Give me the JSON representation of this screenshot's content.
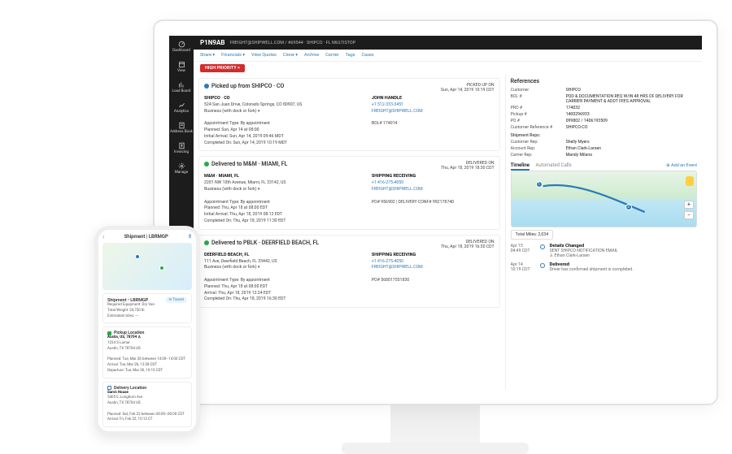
{
  "sidebar_items": [
    "Dashboard",
    "View",
    "Load Board",
    "Analytics",
    "Address Book",
    "Invoicing",
    "Manage"
  ],
  "header": {
    "load_id": "P1N9AB",
    "breadcrumb": "FREIGHT@SHIPWELL.COM / #69544 · SHIPCO · FL MULTISTOP"
  },
  "actions": {
    "share": "Share ▾",
    "financials": "Financials ▾",
    "view_quotes": "View Quotes",
    "clone": "Clone ▾",
    "archive": "Archive",
    "carrier": "Carrier",
    "tags": "Tags",
    "cases": "Cases"
  },
  "priority_tag": "HIGH PRIORITY ×",
  "stops": [
    {
      "status": "pickup",
      "status_dot": "blue",
      "title": "Picked up from SHIPCO · CO",
      "right_label": "PICKED UP ON",
      "right_date": "Sun, Apr 14, 2019 10:19 CDT",
      "block1": {
        "heading": "SHIPCO · CO",
        "addr": "524 San Juan Drive, Colorado Springs, CO 80907, US",
        "hours": "Business (with dock or fork) ▾",
        "l1": "Appointment Type: By appointment",
        "l2": "Planned: Sun, Apr 14 at 08:00",
        "l3": "Initial Arrival: Sun, Apr 14, 2019 09:46 MDT",
        "l4": "Completed On: Sun, Apr 14, 2019 10:19 MDT"
      },
      "block2": {
        "heading": "JOHN HANDLE",
        "phone": "+1 512-333-3451",
        "email": "FREIGHT@SHIPWELL.COM",
        "bol": "BOL# 174014"
      }
    },
    {
      "status": "delivered",
      "status_dot": "green",
      "title": "Delivered to M&M · MIAMI, FL",
      "right_label": "DELIVERED ON",
      "right_date": "Thu, Apr 18, 2019 18:30 CDT",
      "block1": {
        "heading": "M&M · MIAMI, FL",
        "addr": "2281 NW 10th Avenue, Miami, FL 33142, US",
        "hours": "Business (with dock or fork) ▾",
        "l1": "Appointment Type: By appointment",
        "l2": "Planned: Thu, Apr 18 at 08:00 EDT",
        "l3": "Initial Arrival: Thu, Apr 18, 2019 08:12 EDT",
        "l4": "Completed On: Thu, Apr 18, 2019 11:30 EDT"
      },
      "block2": {
        "heading": "SHIPPING RECEIVING",
        "phone": "+1 416-275-4050",
        "email": "FREIGHT@SHIPWELL.COM",
        "bol": "PO# 956902 | DELIVERY CONF# 992178740"
      }
    },
    {
      "status": "delivered",
      "status_dot": "green",
      "title": "Delivered to PBLK · DEERFIELD BEACH, FL",
      "right_label": "DELIVERED ON",
      "right_date": "Thu, Apr 18, 2019 16:30 CDT",
      "block1": {
        "heading": "DEERFIELD BEACH, FL",
        "addr": "111 Ave, Deerfield Beach, FL 33442, US",
        "hours": "Business (with dock or fork) ▾",
        "l1": "Appointment Type: By appointment",
        "l2": "Planned: Thu, Apr 18 at 08:00 EDT",
        "l3": "Arrival: Thu, Apr 18, 2019 12:24 EDT",
        "l4": "Completed On: Thu, Apr 18, 2019 16:30 EDT"
      },
      "block2": {
        "heading": "SHIPPING RECEIVING",
        "phone": "+1 416-275-4050",
        "email": "FREIGHT@SHIPWELL.COM",
        "bol": "PO# 568017551830"
      }
    }
  ],
  "references": {
    "title": "References",
    "rows": [
      {
        "k": "Customer",
        "v": "SHIPCO"
      },
      {
        "k": "BOL #",
        "v": "POD & DOCUMENTATION REQ W/IN 48 HRS OF DELIVERY FOR CARRIER PAYMENT & ADDT FEES APPROVAL"
      },
      {
        "k": "PRO #",
        "v": "174032"
      },
      {
        "k": "Pickup #",
        "v": "1400296933"
      },
      {
        "k": "PO #",
        "v": "099802 / 1406193509"
      },
      {
        "k": "Customer Reference #",
        "v": "SHIPCO-CO"
      }
    ],
    "reps_label": "Shipment Reps:",
    "reps": [
      {
        "k": "Customer Rep:",
        "v": "Shelly Myers"
      },
      {
        "k": "Account Rep:",
        "v": "Ethan Clark-Larsen"
      },
      {
        "k": "Carrier Rep:",
        "v": "Mandy Milano"
      }
    ]
  },
  "timeline": {
    "tab_timeline": "Timeline",
    "tab_calls": "Automated Calls",
    "add_event": "⊕ Add an Event",
    "total_miles": "Total Miles: 2,034",
    "events": [
      {
        "date1": "Apr 15",
        "date2": "04:49 CDT",
        "title": "Details Changed",
        "line1": "SENT SHIPCO NOTIFICATION EMAIL",
        "line2": "♙ Ethan Clark-Larsen"
      },
      {
        "date1": "Apr 14",
        "date2": "10:19 CDT",
        "title": "Delivered",
        "line1": "Driver has confirmed shipment is completed.",
        "line2": ""
      }
    ]
  },
  "phone": {
    "title": "Shipment | LBRMGP",
    "card1": {
      "heading": "Shipment • LBRMGP",
      "badge": "In Transit",
      "eq": "Required Equipment: Dry Van",
      "wt": "Total Weight: 24,720 lb",
      "eta": "Estimated miles: ---"
    },
    "pickup": {
      "heading": "Pickup Location",
      "name": "Austin, US, 78704 ♙",
      "addr1": "1234 S Lamar",
      "addr2": "Austin, TX 78704 US",
      "planned": "Planned: Tue, Mar 26 between 14:00–14:00 CDT",
      "arrival": "Arrival: Tue, Mar 26, 13:28 CDT",
      "departure": "Departure: Tue, Mar 26, 16:10 CDT"
    },
    "delivery": {
      "heading": "Delivery Location",
      "name": "Sam's House",
      "addr1": "5405 E, Longhorn Ave",
      "addr2": "Austin, TX 78704 US",
      "planned": "Planned: Sat, Feb 23 between 00:00–00:00 CST",
      "arrival": "Arrival: Fri, Feb 22, 10:13 CT"
    }
  }
}
